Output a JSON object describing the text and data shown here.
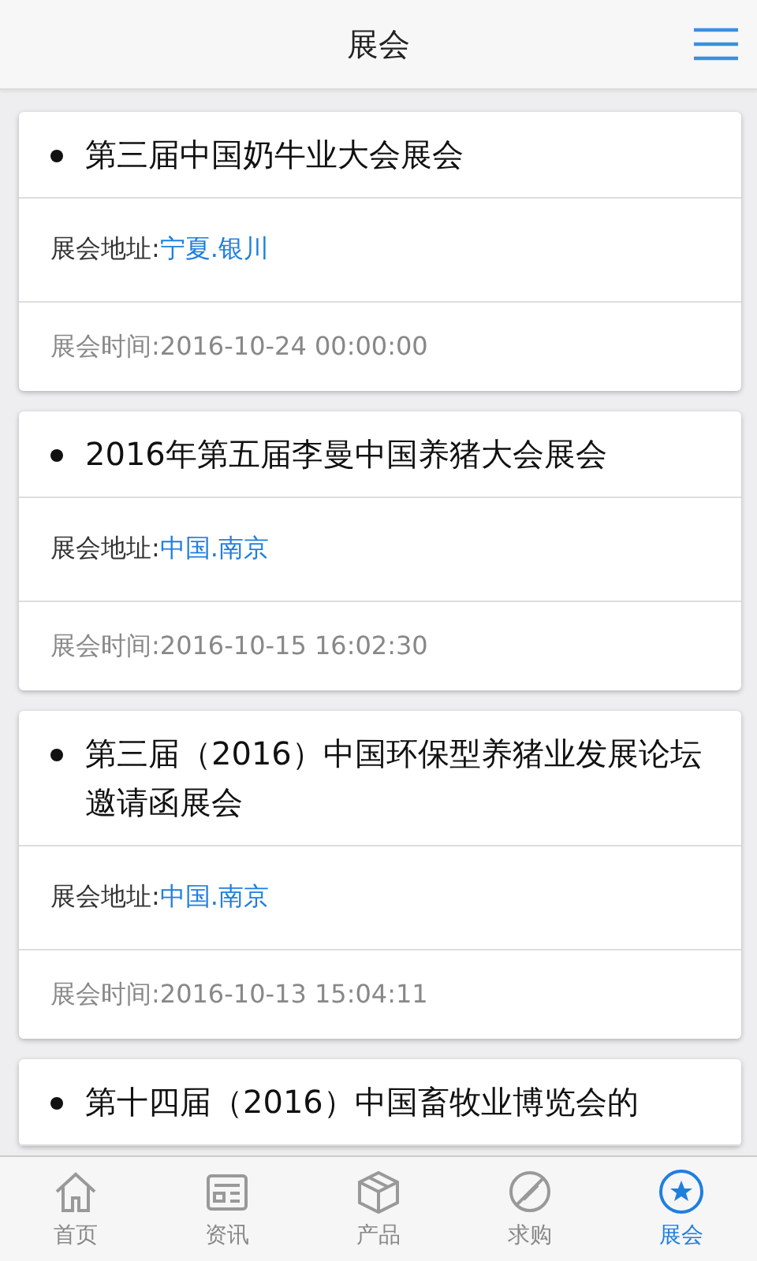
{
  "header": {
    "title": "展会"
  },
  "exhibitions": [
    {
      "title": "第三届中国奶牛业大会展会",
      "address_label": "展会地址:",
      "address": "宁夏.银川",
      "time_label": "展会时间:",
      "time": "2016-10-24 00:00:00"
    },
    {
      "title": "2016年第五届李曼中国养猪大会展会",
      "address_label": "展会地址:",
      "address": "中国.南京",
      "time_label": "展会时间:",
      "time": "2016-10-15 16:02:30"
    },
    {
      "title": "第三届（2016）中国环保型养猪业发展论坛邀请函展会",
      "address_label": "展会地址:",
      "address": "中国.南京",
      "time_label": "展会时间:",
      "time": "2016-10-13 15:04:11"
    },
    {
      "title": "第十四届（2016）中国畜牧业博览会的"
    }
  ],
  "tab_bar": [
    {
      "label": "首页",
      "kind": "home",
      "selected": false
    },
    {
      "label": "资讯",
      "kind": "news",
      "selected": false
    },
    {
      "label": "产品",
      "kind": "product",
      "selected": false
    },
    {
      "label": "求购",
      "kind": "purchase",
      "selected": false
    },
    {
      "label": "展会",
      "kind": "expo",
      "selected": true
    }
  ]
}
